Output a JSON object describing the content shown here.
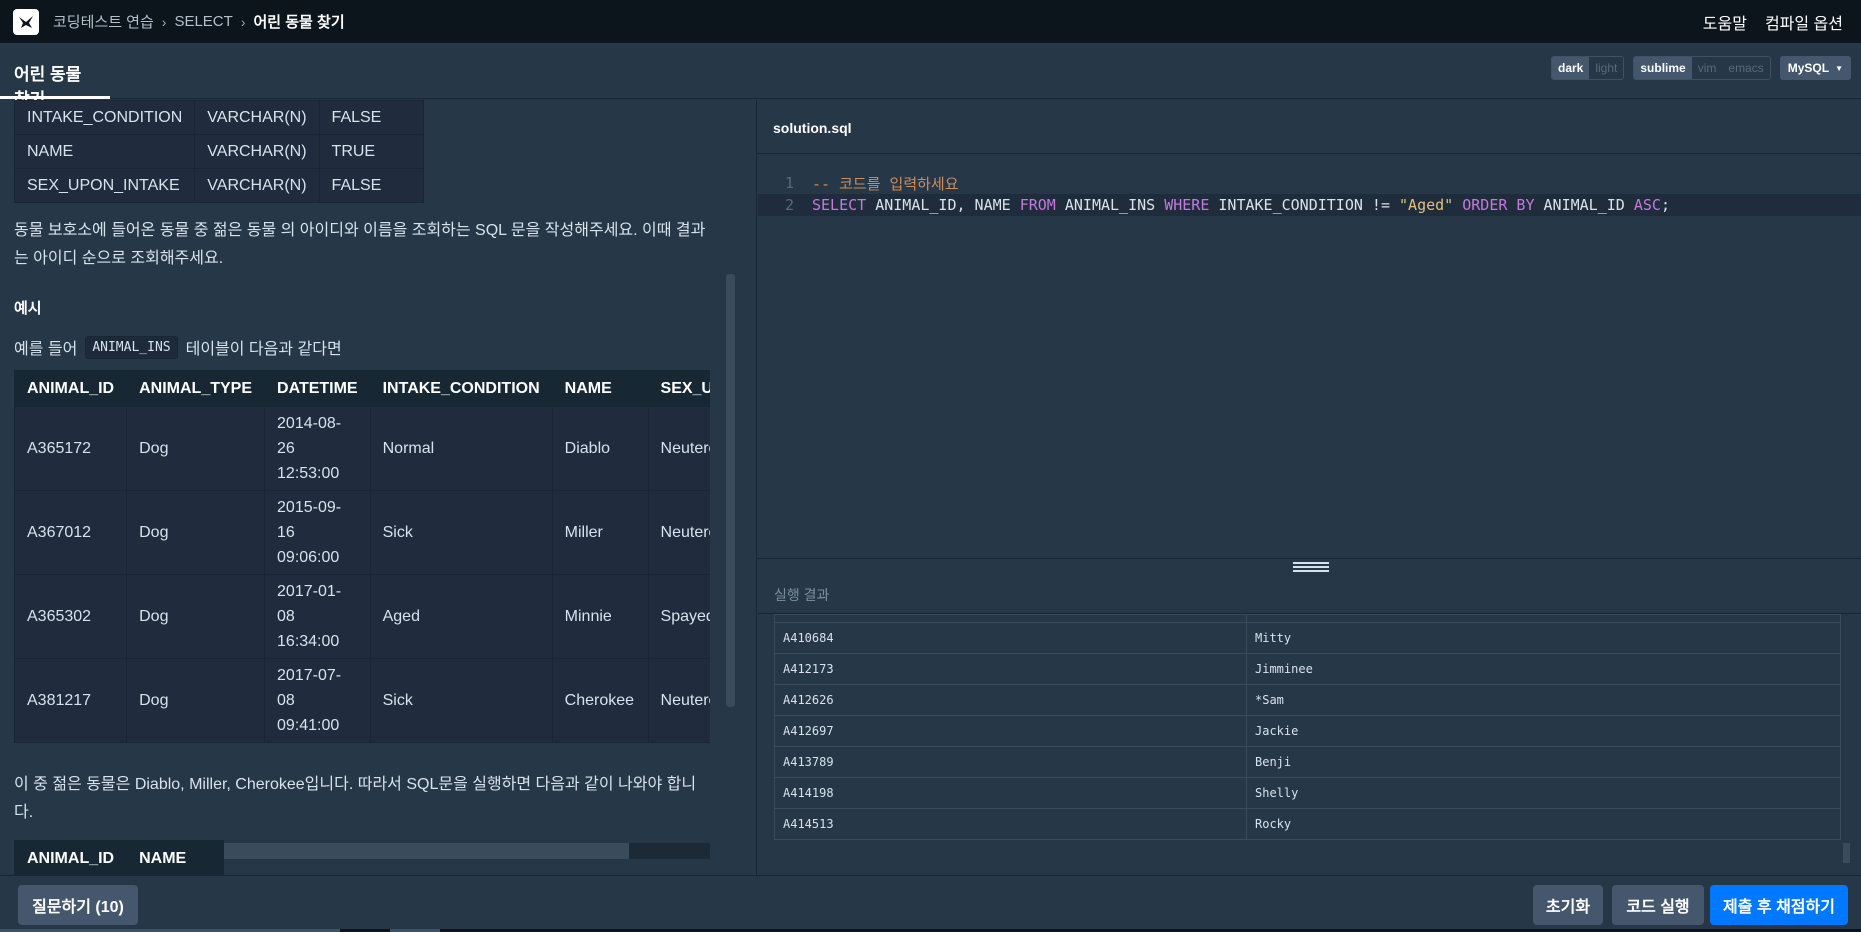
{
  "breadcrumb": [
    "코딩테스트 연습",
    "SELECT",
    "어린 동물 찾기"
  ],
  "top_links": [
    "도움말",
    "컴파일 옵션"
  ],
  "problem_tab": "어린 동물 찾기",
  "settings": {
    "theme": [
      "dark",
      "light"
    ],
    "keymap": [
      "sublime",
      "vim",
      "emacs"
    ],
    "language": "MySQL"
  },
  "schema_rows": [
    [
      "INTAKE_CONDITION",
      "VARCHAR(N)",
      "FALSE"
    ],
    [
      "NAME",
      "VARCHAR(N)",
      "TRUE"
    ],
    [
      "SEX_UPON_INTAKE",
      "VARCHAR(N)",
      "FALSE"
    ]
  ],
  "description": "동물 보호소에 들어온 동물 중 젊은 동물 의 아이디와 이름을 조회하는 SQL 문을 작성해주세요. 이때 결과는 아이디 순으로 조회해주세요.",
  "example_heading": "예시",
  "example_intro": {
    "before": "예를 들어",
    "code": "ANIMAL_INS",
    "after": "테이블이 다음과 같다면"
  },
  "example_table": {
    "headers": [
      "ANIMAL_ID",
      "ANIMAL_TYPE",
      "DATETIME",
      "INTAKE_CONDITION",
      "NAME",
      "SEX_UPC"
    ],
    "rows": [
      [
        "A365172",
        "Dog",
        "2014-08-26 12:53:00",
        "Normal",
        "Diablo",
        "Neuterec"
      ],
      [
        "A367012",
        "Dog",
        "2015-09-16 09:06:00",
        "Sick",
        "Miller",
        "Neuterec"
      ],
      [
        "A365302",
        "Dog",
        "2017-01-08 16:34:00",
        "Aged",
        "Minnie",
        "Spayed F"
      ],
      [
        "A381217",
        "Dog",
        "2017-07-08 09:41:00",
        "Sick",
        "Cherokee",
        "Neuterec"
      ]
    ]
  },
  "result_text": "이 중 젊은 동물은 Diablo, Miller, Cherokee입니다. 따라서 SQL문을 실행하면 다음과 같이 나와야 합니다.",
  "result_table_headers": [
    "ANIMAL_ID",
    "NAME"
  ],
  "editor": {
    "filename": "solution.sql",
    "line_numbers": [
      "1",
      "2"
    ],
    "comment": "-- 코드를 입력하세요"
  },
  "query_tokens": [
    {
      "t": "SELECT",
      "c": "kw"
    },
    {
      "t": " ANIMAL_ID, NAME ",
      "c": ""
    },
    {
      "t": "FROM",
      "c": "kw"
    },
    {
      "t": " ANIMAL_INS ",
      "c": ""
    },
    {
      "t": "WHERE",
      "c": "kw"
    },
    {
      "t": " INTAKE_CONDITION != ",
      "c": ""
    },
    {
      "t": "\"Aged\"",
      "c": "str"
    },
    {
      "t": " ",
      "c": ""
    },
    {
      "t": "ORDER BY",
      "c": "kw"
    },
    {
      "t": " ANIMAL_ID ",
      "c": ""
    },
    {
      "t": "ASC",
      "c": "kw"
    },
    {
      "t": ";",
      "c": ""
    }
  ],
  "run_result": {
    "title": "실행 결과",
    "rows": [
      [
        "A410684",
        "Mitty"
      ],
      [
        "A412173",
        "Jimminee"
      ],
      [
        "A412626",
        "*Sam"
      ],
      [
        "A412697",
        "Jackie"
      ],
      [
        "A413789",
        "Benji"
      ],
      [
        "A414198",
        "Shelly"
      ],
      [
        "A414513",
        "Rocky"
      ]
    ]
  },
  "buttons": {
    "ask": "질문하기 (10)",
    "reset": "초기화",
    "run": "코드 실행",
    "submit": "제출 후 채점하기"
  }
}
